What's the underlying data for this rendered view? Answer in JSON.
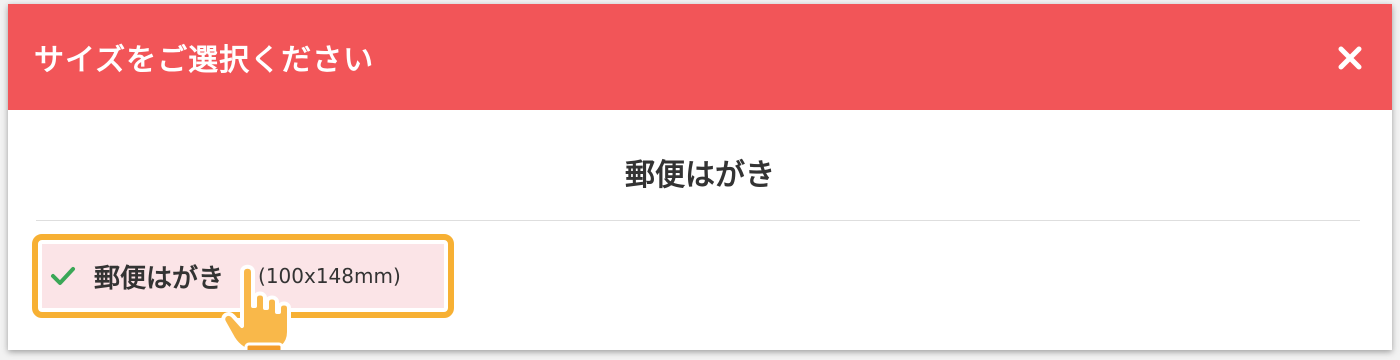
{
  "modal": {
    "title": "サイズをご選択ください",
    "close_icon": "close-icon"
  },
  "section": {
    "title": "郵便はがき"
  },
  "options": [
    {
      "label": "郵便はがき",
      "dimensions": "(100x148mm)",
      "selected": true,
      "icon": "check-icon"
    }
  ],
  "colors": {
    "header_bg": "#f25558",
    "highlight_border": "#f7b033",
    "selected_bg": "#fbe4e7",
    "check": "#3aa757"
  }
}
